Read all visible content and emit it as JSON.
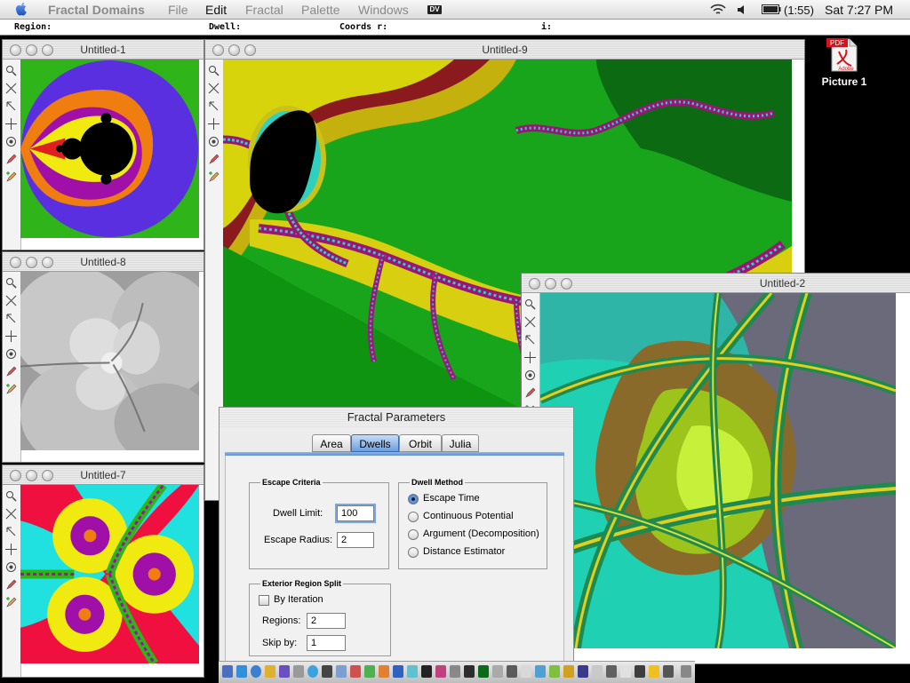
{
  "menubar": {
    "app_name": "Fractal Domains",
    "items": [
      "File",
      "Edit",
      "Fractal",
      "Palette",
      "Windows"
    ],
    "active_item": "Edit",
    "extra": "DV",
    "battery": "(1:55)",
    "clock": "Sat 7:27 PM"
  },
  "statusbar": {
    "region": "Region:",
    "dwell": "Dwell:",
    "coords": "Coords r:",
    "i": "i:"
  },
  "windows": {
    "w1": {
      "title": "Untitled-1"
    },
    "w8": {
      "title": "Untitled-8"
    },
    "w7": {
      "title": "Untitled-7"
    },
    "w9": {
      "title": "Untitled-9"
    },
    "w2": {
      "title": "Untitled-2"
    }
  },
  "dialog": {
    "title": "Fractal Parameters",
    "tabs": [
      "Area",
      "Dwells",
      "Orbit",
      "Julia"
    ],
    "selected_tab": "Dwells",
    "escape": {
      "group_label": "Escape Criteria",
      "dwell_limit_label": "Dwell Limit:",
      "dwell_limit_value": "100",
      "escape_radius_label": "Escape Radius:",
      "escape_radius_value": "2"
    },
    "dwell_method": {
      "group_label": "Dwell Method",
      "options": [
        "Escape Time",
        "Continuous Potential",
        "Argument (Decomposition)",
        "Distance Estimator"
      ],
      "selected": "Escape Time"
    },
    "exterior": {
      "group_label": "Exterior Region Split",
      "by_iteration_label": "By Iteration",
      "by_iteration_checked": false,
      "regions_label": "Regions:",
      "regions_value": "2",
      "skip_label": "Skip by:",
      "skip_value": "1"
    }
  },
  "desktop": {
    "icon_label": "Picture 1",
    "badge": "PDF",
    "brand": "Adobe"
  },
  "colors": {
    "green_bg": "#2fb51a",
    "violet": "#5a2fe0",
    "orange": "#ef7d10",
    "teal": "#1fd0b3",
    "magenta": "#a010a8",
    "yellow": "#f0ea10",
    "red": "#f01040",
    "cyan": "#20e0e0",
    "dialog_tab": "#5f8fd6"
  }
}
